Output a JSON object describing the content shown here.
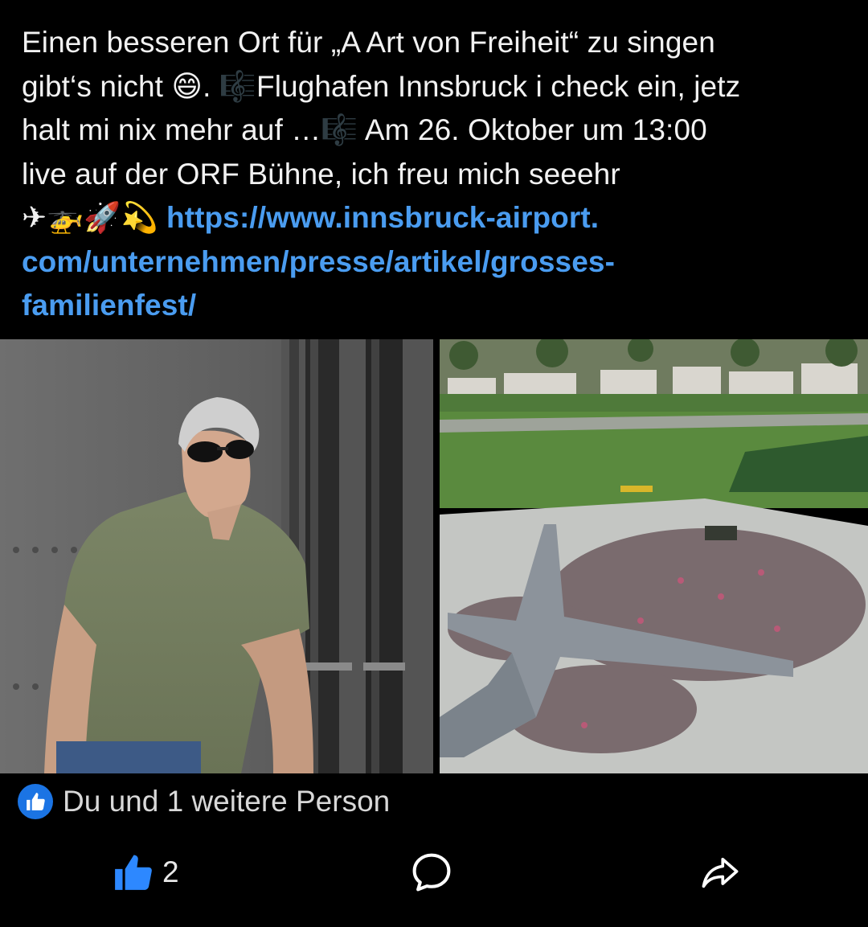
{
  "post": {
    "text_line1": "Einen besseren Ort für „A Art von Freiheit“ zu singen",
    "text_line2_a": "gibt‘s nicht ",
    "text_line2_emoji": "😄",
    "text_line2_b": ". ",
    "text_line2_music": "🎼",
    "text_line2_c": "Flughafen Innsbruck i check ein, jetz",
    "text_line3_a": "halt mi nix mehr auf …",
    "text_line3_music": "🎼",
    "text_line3_b": " Am 26. Oktober um 13:00",
    "text_line4": "live auf der ORF Bühne, ich freu mich seeehr",
    "emojis": "✈🚁🚀💫",
    "link_line1": "https://www.innsbruck-airport.",
    "link_line2": "com/unternehmen/presse/artikel/grosses-",
    "link_line3": "familienfest/"
  },
  "reactions": {
    "summary": "Du und 1 weitere Person"
  },
  "actions": {
    "like_count": "2",
    "like_icon": "thumbs-up-icon",
    "comment_icon": "comment-bubble-icon",
    "share_icon": "share-arrow-icon"
  },
  "colors": {
    "accent": "#1b74e4",
    "link": "#4a9cf0",
    "background": "#000000"
  }
}
